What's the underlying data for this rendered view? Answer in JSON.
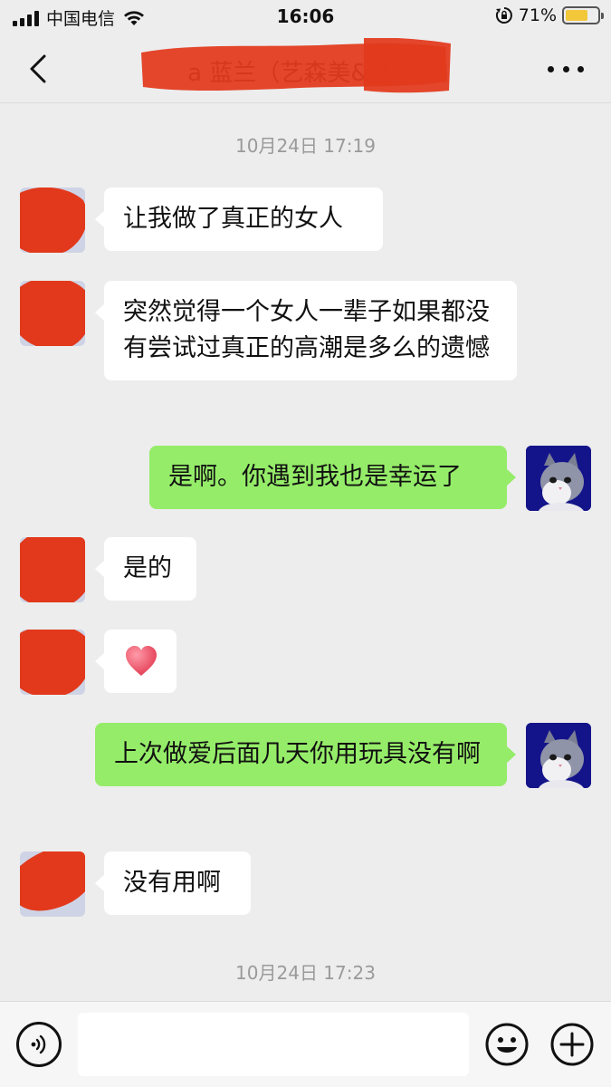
{
  "status_bar": {
    "carrier": "中国电信",
    "time": "16:06",
    "battery_text": "71%",
    "battery_level": 0.71
  },
  "header": {
    "title": "a 蓝兰（艺森美&艺  ）"
  },
  "timestamps": [
    "10月24日 17:19",
    "10月24日 17:23"
  ],
  "messages": [
    {
      "side": "in",
      "text": "让我做了真正的女人"
    },
    {
      "side": "in",
      "text": "突然觉得一个女人一辈子如果都没有尝试过真正的高潮是多么的遗憾"
    },
    {
      "side": "out",
      "text": "是啊。你遇到我也是幸运了"
    },
    {
      "side": "in",
      "text": "是的"
    },
    {
      "side": "in",
      "emoji": "heart"
    },
    {
      "side": "out",
      "text": "上次做爱后面几天你用玩具没有啊"
    },
    {
      "side": "in",
      "text": "没有用啊"
    }
  ],
  "input": {
    "placeholder": ""
  },
  "colors": {
    "background": "#ededed",
    "outgoing_bubble": "#95ec69",
    "incoming_bubble": "#ffffff",
    "redaction": "#e2391c",
    "battery_fill": "#f2c83a"
  },
  "icons": [
    "signal-icon",
    "wifi-icon",
    "lock-rotation-icon",
    "battery-icon",
    "back-chevron-icon",
    "more-dots-icon",
    "heart-emoji-icon",
    "voice-icon",
    "emoji-icon",
    "plus-icon"
  ]
}
